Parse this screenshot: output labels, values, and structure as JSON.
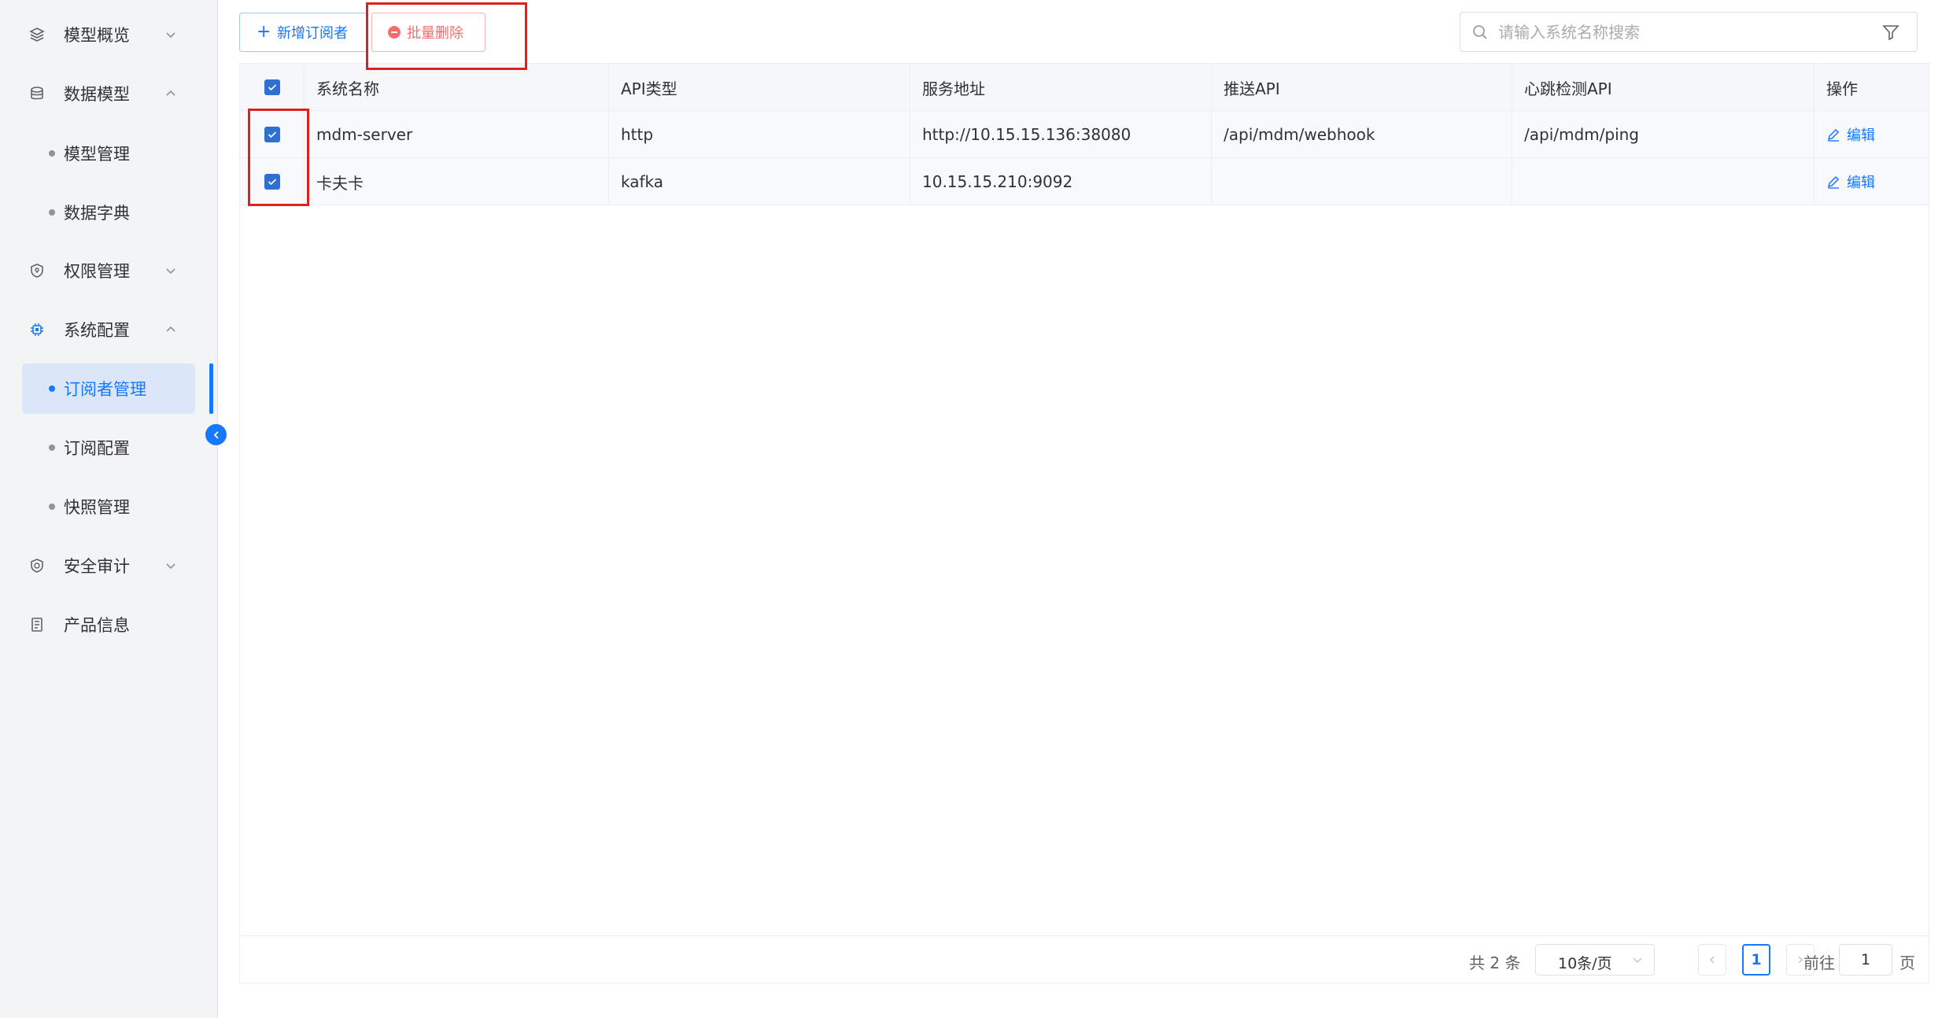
{
  "sidebar": {
    "menu": [
      {
        "label": "模型概览",
        "icon": "layers-icon",
        "arrow": "down"
      },
      {
        "label": "数据模型",
        "icon": "database-icon",
        "arrow": "up"
      },
      {
        "label": "权限管理",
        "icon": "shield-icon",
        "arrow": "down"
      },
      {
        "label": "系统配置",
        "icon": "chip-icon",
        "arrow": "up"
      },
      {
        "label": "安全审计",
        "icon": "shield-check-icon",
        "arrow": "down"
      },
      {
        "label": "产品信息",
        "icon": "document-icon"
      }
    ],
    "data_model_children": [
      "模型管理",
      "数据字典"
    ],
    "system_config_children": [
      "订阅者管理",
      "订阅配置",
      "快照管理"
    ],
    "active_item": "订阅者管理"
  },
  "toolbar": {
    "add_label": "新增订阅者",
    "delete_label": "批量删除",
    "search_placeholder": "请输入系统名称搜索"
  },
  "table": {
    "columns": [
      "系统名称",
      "API类型",
      "服务地址",
      "推送API",
      "心跳检测API",
      "操作"
    ],
    "rows": [
      {
        "checked": true,
        "name": "mdm-server",
        "api_type": "http",
        "address": "http://10.15.15.136:38080",
        "push_api": "/api/mdm/webhook",
        "heartbeat_api": "/api/mdm/ping",
        "action": "编辑"
      },
      {
        "checked": true,
        "name": "卡夫卡",
        "api_type": "kafka",
        "address": "10.15.15.210:9092",
        "push_api": "",
        "heartbeat_api": "",
        "action": "编辑"
      }
    ],
    "header_checked": true
  },
  "pagination": {
    "total_text": "共 2 条",
    "page_size": "10条/页",
    "current_page": "1",
    "goto_prefix": "前往",
    "goto_value": "1",
    "goto_suffix": "页"
  },
  "colors": {
    "primary": "#1677ff",
    "danger": "#f56c6c",
    "highlight_box": "#e02020"
  }
}
